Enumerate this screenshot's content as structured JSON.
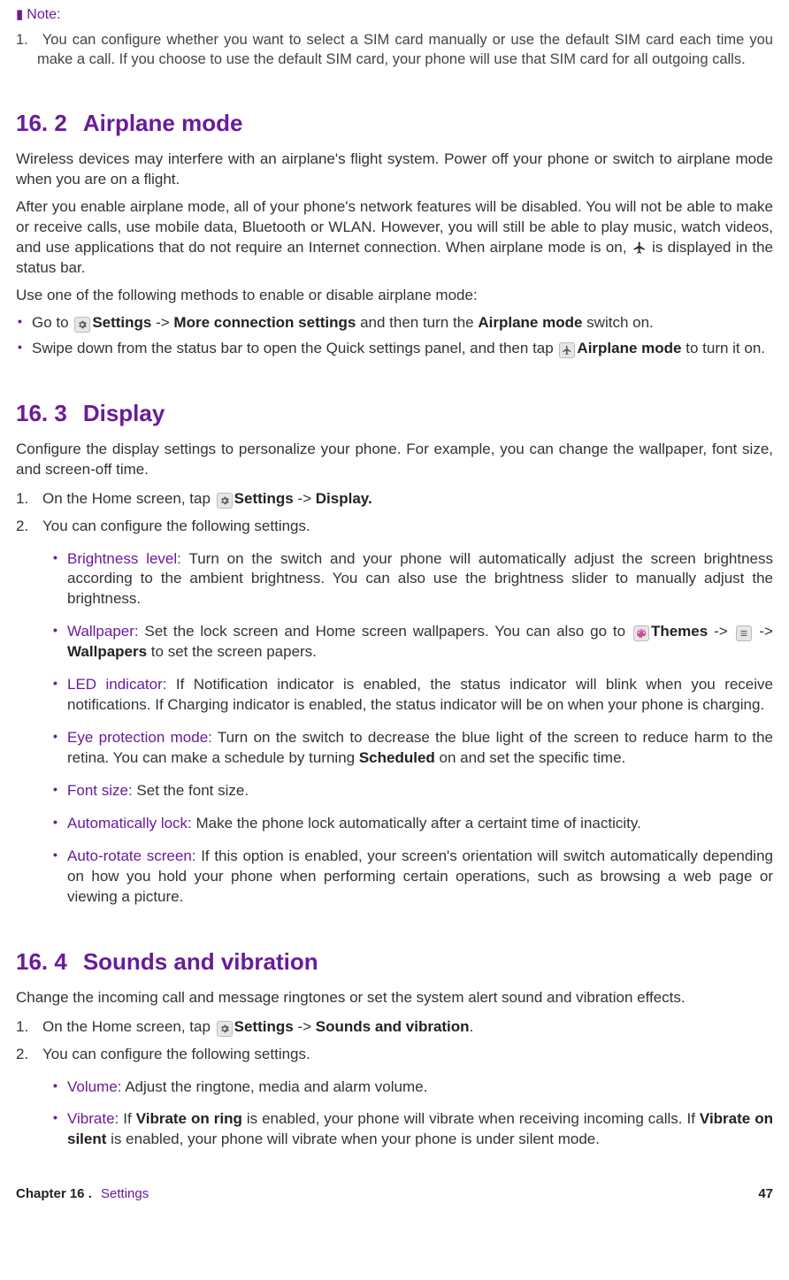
{
  "note": {
    "label": "Note:",
    "num": "1.",
    "text": "You can configure whether you want to select a SIM card manually or use the default SIM card each time you make a call. If you choose to use the default SIM card, your phone will use that SIM card for all outgoing calls."
  },
  "s162": {
    "num": "16. 2",
    "title": "Airplane mode",
    "p1": "Wireless devices may interfere with an airplane's flight system. Power off your phone or switch to airplane mode when you are on a flight.",
    "p2a": "After you enable airplane mode, all of your phone's network features will be disabled. You will not be able to make or receive calls, use mobile data, Bluetooth or WLAN. However, you will still be able to play music, watch videos, and use applications that do not require an Internet connection. When airplane mode is on, ",
    "p2b": " is displayed in the status bar.",
    "p3": "Use one of the following methods to enable or disable airplane mode:",
    "b1a": "Go to ",
    "b1_settings": "Settings",
    "b1b": " -> ",
    "b1_more": "More connection settings",
    "b1c": " and then turn the ",
    "b1_air": "Airplane mode",
    "b1d": " switch on.",
    "b2a": "Swipe down from the status bar to open the Quick settings panel, and then tap ",
    "b2_air": "Airplane mode",
    "b2b": " to turn it on."
  },
  "s163": {
    "num": "16. 3",
    "title": "Display",
    "p1": "Configure the display settings to personalize your phone. For example, you can change the wallpaper, font size, and screen-off time.",
    "step1a": "On the Home screen, tap ",
    "step1_settings": "Settings",
    "step1b": " -> ",
    "step1_display": "Display.",
    "step2": "You can configure the following settings.",
    "brightness_t": "Brightness level:",
    "brightness": " Turn on the switch and your phone will automatically adjust the screen brightness according to the ambient brightness. You can also use the brightness slider to manually adjust the brightness.",
    "wallpaper_t": "Wallpaper:",
    "wallpaper_a": " Set the lock screen and Home screen wallpapers. You can also go to ",
    "wallpaper_themes": "Themes",
    "wallpaper_b": " -> ",
    "wallpaper_c": " -> ",
    "wallpaper_wall": "Wallpapers",
    "wallpaper_d": " to set the screen papers.",
    "led_t": "LED indicator:",
    "led": " If Notification indicator is enabled, the status indicator will blink when you receive notifications. If Charging indicator is enabled, the status indicator will be on when your phone is charging.",
    "eye_t": "Eye protection mode:",
    "eye_a": " Turn on the switch to decrease the blue light of the screen to reduce harm to the retina. You can make a schedule by turning ",
    "eye_sched": "Scheduled",
    "eye_b": " on and set the specific time.",
    "font_t": "Font size:",
    "font": " Set the font size.",
    "autolock_t": "Automatically lock:",
    "autolock": " Make the phone lock automatically after a certaint time of inacticity.",
    "autorot_t": "Auto-rotate screen:",
    "autorot": " If this option is enabled, your screen's orientation will switch automatically depending on how you hold your phone when performing certain operations, such as browsing a web page or viewing a picture."
  },
  "s164": {
    "num": "16. 4",
    "title": "Sounds and vibration",
    "p1": "Change the incoming call and message ringtones or set the system alert sound and vibration effects.",
    "step1a": "On the Home screen, tap ",
    "step1_settings": "Settings",
    "step1b": " -> ",
    "step1_sv": "Sounds and vibration",
    "step1c": ".",
    "step2": "You can configure the following settings.",
    "volume_t": "Volume:",
    "volume": " Adjust the ringtone, media and alarm volume.",
    "vibrate_t": "Vibrate:",
    "vibrate_a": " If ",
    "vibrate_vor": "Vibrate on ring",
    "vibrate_b": " is enabled, your phone will vibrate when receiving incoming calls. If ",
    "vibrate_vos": "Vibrate on silent",
    "vibrate_c": " is enabled, your phone will vibrate when your phone is under silent mode."
  },
  "footer": {
    "chapter": "Chapter 16 .",
    "name": "Settings",
    "page": "47"
  }
}
